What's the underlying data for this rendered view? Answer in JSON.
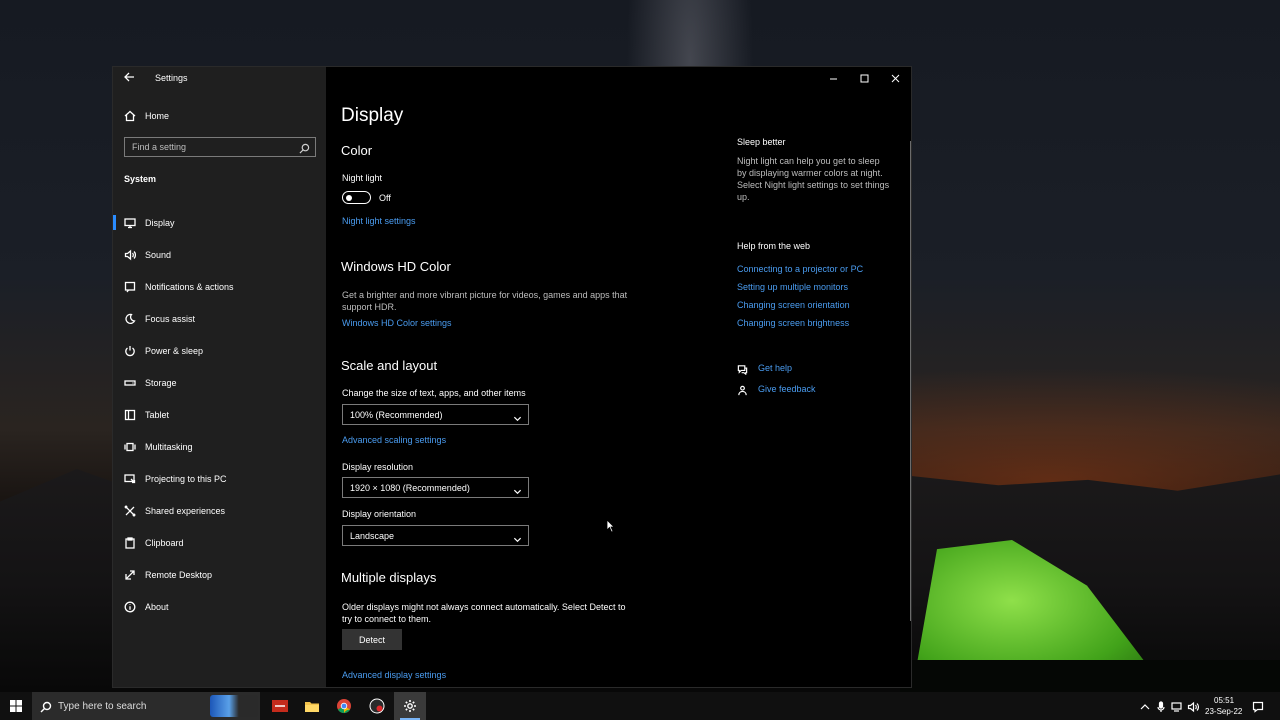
{
  "window": {
    "app_title": "Settings",
    "home_label": "Home",
    "search_placeholder": "Find a setting",
    "section_title": "System"
  },
  "sidebar": {
    "items": [
      {
        "label": "Display",
        "icon": "monitor-icon",
        "selected": true
      },
      {
        "label": "Sound",
        "icon": "speaker-icon"
      },
      {
        "label": "Notifications & actions",
        "icon": "notification-icon"
      },
      {
        "label": "Focus assist",
        "icon": "moon-icon"
      },
      {
        "label": "Power & sleep",
        "icon": "power-icon"
      },
      {
        "label": "Storage",
        "icon": "storage-icon"
      },
      {
        "label": "Tablet",
        "icon": "tablet-icon"
      },
      {
        "label": "Multitasking",
        "icon": "multitasking-icon"
      },
      {
        "label": "Projecting to this PC",
        "icon": "projecting-icon"
      },
      {
        "label": "Shared experiences",
        "icon": "shared-experiences-icon"
      },
      {
        "label": "Clipboard",
        "icon": "clipboard-icon"
      },
      {
        "label": "Remote Desktop",
        "icon": "remote-desktop-icon"
      },
      {
        "label": "About",
        "icon": "info-icon"
      }
    ]
  },
  "main": {
    "page_title": "Display",
    "color": {
      "heading": "Color",
      "night_light_label": "Night light",
      "night_light_state": "Off",
      "night_light_link": "Night light settings"
    },
    "hd_color": {
      "heading": "Windows HD Color",
      "description_line1": "Get a brighter and more vibrant picture for videos, games and apps that",
      "description_line2": "support HDR.",
      "link": "Windows HD Color settings"
    },
    "scale": {
      "heading": "Scale and layout",
      "size_label": "Change the size of text, apps, and other items",
      "size_value": "100% (Recommended)",
      "advanced_scaling_link": "Advanced scaling settings",
      "resolution_label": "Display resolution",
      "resolution_value": "1920 × 1080 (Recommended)",
      "orientation_label": "Display orientation",
      "orientation_value": "Landscape"
    },
    "multiple": {
      "heading": "Multiple displays",
      "description_line1": "Older displays might not always connect automatically. Select Detect to",
      "description_line2": "try to connect to them.",
      "detect_label": "Detect",
      "advanced_display_link": "Advanced display settings"
    }
  },
  "right": {
    "sleep_title": "Sleep better",
    "sleep_lines": [
      "Night light can help you get to sleep",
      "by displaying warmer colors at night.",
      "Select Night light settings to set things",
      "up."
    ],
    "help_title": "Help from the web",
    "help_links": [
      "Connecting to a projector or PC",
      "Setting up multiple monitors",
      "Changing screen orientation",
      "Changing screen brightness"
    ],
    "get_help": "Get help",
    "give_feedback": "Give feedback"
  },
  "taskbar": {
    "search_placeholder": "Type here to search",
    "time": "05:51",
    "date": "23-Sep-22",
    "apps": [
      "voice-recorder-app",
      "file-explorer-app",
      "chrome-app",
      "obs-app",
      "settings-app"
    ]
  },
  "colors": {
    "accent": "#2a8cff",
    "link": "#4a9cf0",
    "sidebar_bg": "#1f1f1f",
    "content_bg": "#000000"
  }
}
